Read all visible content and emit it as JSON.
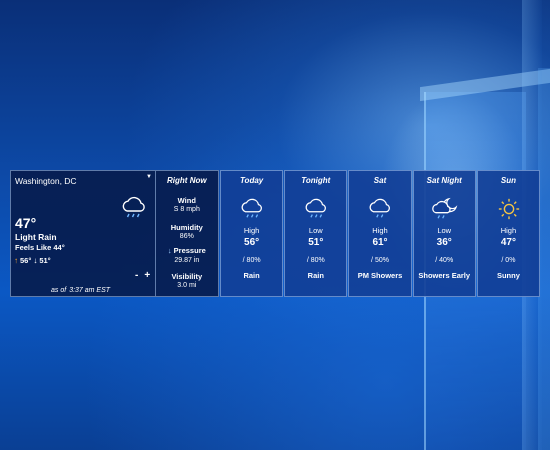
{
  "current": {
    "location": "Washington, DC",
    "temperature": "47°",
    "condition": "Light Rain",
    "feels_like_label": "Feels Like",
    "feels_like": "44°",
    "high": "56°",
    "low": "51°",
    "zoom_out": "-",
    "zoom_in": "+",
    "as_of_label": "as of",
    "as_of_time": "3:37 am EST",
    "icon": "cloud-rain-icon"
  },
  "right_now": {
    "title": "Right Now",
    "wind_label": "Wind",
    "wind_value": "S 8 mph",
    "humidity_label": "Humidity",
    "humidity_value": "86%",
    "pressure_label": "Pressure",
    "pressure_value": "29.87 in",
    "visibility_label": "Visibility",
    "visibility_value": "3.0 mi"
  },
  "forecast": [
    {
      "title": "Today",
      "hl": "High",
      "temp": "56°",
      "precip": "80%",
      "cond": "Rain",
      "icon": "cloud-rain-icon"
    },
    {
      "title": "Tonight",
      "hl": "Low",
      "temp": "51°",
      "precip": "80%",
      "cond": "Rain",
      "icon": "cloud-rain-icon"
    },
    {
      "title": "Sat",
      "hl": "High",
      "temp": "61°",
      "precip": "50%",
      "cond": "PM Showers",
      "icon": "cloud-rain-icon"
    },
    {
      "title": "Sat Night",
      "hl": "Low",
      "temp": "36°",
      "precip": "40%",
      "cond": "Showers Early",
      "icon": "moon-cloud-rain-icon"
    },
    {
      "title": "Sun",
      "hl": "High",
      "temp": "47°",
      "precip": "0%",
      "cond": "Sunny",
      "icon": "sun-icon"
    }
  ],
  "colors": {
    "high_arrow": "#f0a030",
    "sun": "#f5c542"
  }
}
